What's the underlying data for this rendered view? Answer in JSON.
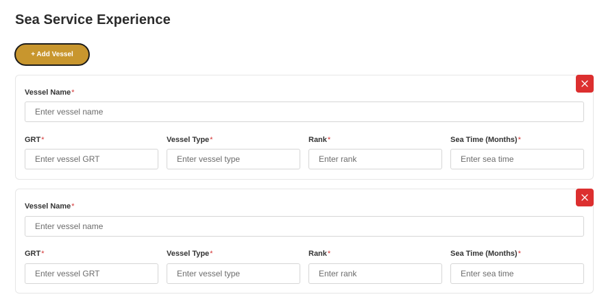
{
  "page": {
    "title": "Sea Service Experience",
    "add_button_label": "+ Add Vessel",
    "required_marker": "*"
  },
  "vessels": [
    {
      "vessel_name": {
        "label": "Vessel Name",
        "placeholder": "Enter vessel name",
        "value": ""
      },
      "grt": {
        "label": "GRT",
        "placeholder": "Enter vessel GRT",
        "value": ""
      },
      "vessel_type": {
        "label": "Vessel Type",
        "placeholder": "Enter vessel type",
        "value": ""
      },
      "rank": {
        "label": "Rank",
        "placeholder": "Enter rank",
        "value": ""
      },
      "sea_time": {
        "label": "Sea Time (Months)",
        "placeholder": "Enter sea time",
        "value": ""
      }
    },
    {
      "vessel_name": {
        "label": "Vessel Name",
        "placeholder": "Enter vessel name",
        "value": ""
      },
      "grt": {
        "label": "GRT",
        "placeholder": "Enter vessel GRT",
        "value": ""
      },
      "vessel_type": {
        "label": "Vessel Type",
        "placeholder": "Enter vessel type",
        "value": ""
      },
      "rank": {
        "label": "Rank",
        "placeholder": "Enter rank",
        "value": ""
      },
      "sea_time": {
        "label": "Sea Time (Months)",
        "placeholder": "Enter sea time",
        "value": ""
      }
    }
  ],
  "colors": {
    "accent_button": "#c8962e",
    "remove_button": "#dc2f2f",
    "required_marker": "#d43333"
  },
  "icons": {
    "remove": "close-icon"
  }
}
